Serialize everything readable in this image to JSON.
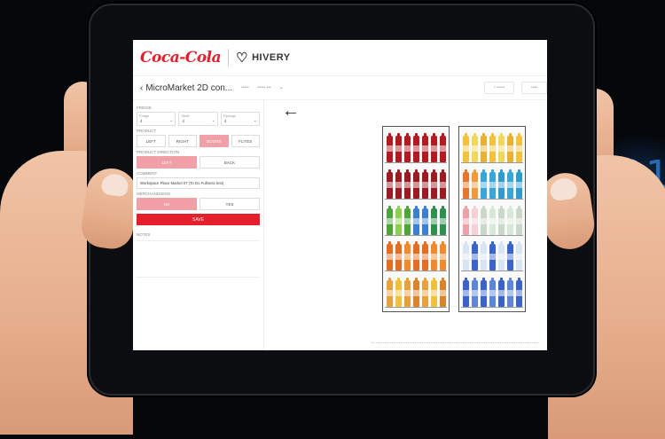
{
  "brand": {
    "coke_logo": "Coca-Cola",
    "hivery_logo": "HIVERY"
  },
  "header": {
    "title": "MicroMarket 2D con...",
    "meta": [
      "•••••",
      "••••• •••"
    ],
    "buttons": [
      "• •••••",
      "••••"
    ]
  },
  "sidebar": {
    "section1_label": "FRIDGE",
    "selects": [
      {
        "label": "Fridge",
        "value": "4"
      },
      {
        "label": "Shelf",
        "value": "4"
      },
      {
        "label": "Facings",
        "value": "4"
      }
    ],
    "section2_label": "PRODUCT",
    "product_tabs": [
      "LEFT",
      "RIGHT",
      "DOORS",
      "FLITES"
    ],
    "direction_label": "PRODUCT DIRECTION",
    "direction_tabs": [
      "LEFT",
      "BACK"
    ],
    "comment_label": "COMMENT",
    "comment_value": "Workspace Place Market 07 (To Do Fullness test)",
    "constraint_label": "MERCHANDISING",
    "constraint_tabs": [
      "NO",
      "YES"
    ],
    "apply_label": "SAVE",
    "notes_label": "NOTES"
  },
  "colors": {
    "accent": "#e41e2b",
    "accent_light": "#f2a0a7"
  },
  "fridges": [
    {
      "shelves": [
        [
          "#b31a22",
          "#b31a22",
          "#b31a22",
          "#b31a22",
          "#b31a22",
          "#b31a22",
          "#b31a22"
        ],
        [
          "#9c1a22",
          "#9c1a22",
          "#9c1a22",
          "#9c1a22",
          "#9c1a22",
          "#9c1a22",
          "#9c1a22"
        ],
        [
          "#4fa53a",
          "#8fcf50",
          "#4fa53a",
          "#3b7fd1",
          "#3b7fd1",
          "#2e8f4e",
          "#2e8f4e"
        ],
        [
          "#e46d24",
          "#e46d24",
          "#f08a2c",
          "#e46d24",
          "#e46d24",
          "#f08a2c",
          "#f08a2c"
        ],
        [
          "#e8a23c",
          "#f0c23c",
          "#e8a23c",
          "#d9832a",
          "#e8a23c",
          "#f0c23c",
          "#d9832a"
        ]
      ]
    },
    {
      "shelves": [
        [
          "#f2c23a",
          "#f2d85a",
          "#e8b230",
          "#f2c23a",
          "#f2d85a",
          "#e8b230",
          "#f2c23a"
        ],
        [
          "#e8762a",
          "#f09a3a",
          "#3aa6d8",
          "#3aa6d8",
          "#2e9ccf",
          "#3aa6d8",
          "#2e9ccf"
        ],
        [
          "#f0a0a8",
          "#f5d0d5",
          "#c9d8c8",
          "#d8e8d8",
          "#c9d8c8",
          "#d8e8d8",
          "#c9d8c8"
        ],
        [
          "#d9e4f2",
          "#3a64c8",
          "#d9e4f2",
          "#3a64c8",
          "#d9e4f2",
          "#3a64c8",
          "#d9e4f2"
        ],
        [
          "#3a64c8",
          "#5d86d8",
          "#3a64c8",
          "#5d86d8",
          "#3a64c8",
          "#5d86d8",
          "#3a64c8"
        ]
      ]
    }
  ]
}
